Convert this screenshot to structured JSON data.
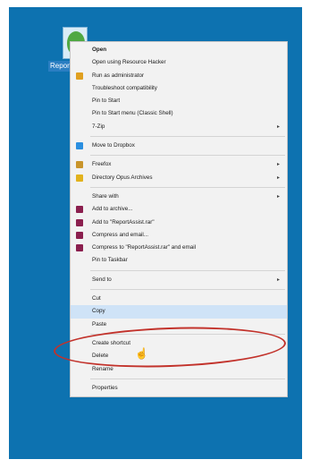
{
  "desktop_icon": {
    "label": "ReportAssist"
  },
  "menu": {
    "groups": [
      [
        {
          "label": "Open",
          "bold": true
        },
        {
          "label": "Open using Resource Hacker"
        },
        {
          "label": "Run as administrator",
          "icon": "shield-icon",
          "color": "#e0a020"
        },
        {
          "label": "Troubleshoot compatibility"
        },
        {
          "label": "Pin to Start"
        },
        {
          "label": "Pin to Start menu (Classic Shell)"
        },
        {
          "label": "7-Zip",
          "submenu": true
        }
      ],
      [
        {
          "label": "Move to Dropbox",
          "icon": "dropbox-icon",
          "color": "#2b8fe0"
        }
      ],
      [
        {
          "label": "Freefox",
          "icon": "folder-icon",
          "color": "#c9952b",
          "submenu": true
        },
        {
          "label": "Directory Opus Archives",
          "icon": "archive-icon",
          "color": "#e2b21d",
          "submenu": true
        }
      ],
      [
        {
          "label": "Share with",
          "submenu": true
        },
        {
          "label": "Add to archive...",
          "icon": "winrar-icon",
          "color": "#8b1f4e"
        },
        {
          "label": "Add to \"ReportAssist.rar\"",
          "icon": "winrar-icon",
          "color": "#8b1f4e"
        },
        {
          "label": "Compress and email...",
          "icon": "winrar-icon",
          "color": "#8b1f4e"
        },
        {
          "label": "Compress to \"ReportAssist.rar\" and email",
          "icon": "winrar-icon",
          "color": "#8b1f4e"
        },
        {
          "label": "Pin to Taskbar"
        }
      ],
      [
        {
          "label": "Send to",
          "submenu": true
        }
      ],
      [
        {
          "label": "Cut"
        },
        {
          "label": "Copy",
          "highlight": true
        },
        {
          "label": "Paste"
        }
      ],
      [
        {
          "label": "Create shortcut"
        },
        {
          "label": "Delete"
        },
        {
          "label": "Rename"
        }
      ],
      [
        {
          "label": "Properties"
        }
      ]
    ]
  },
  "annotation": {
    "color": "#c2322b"
  }
}
